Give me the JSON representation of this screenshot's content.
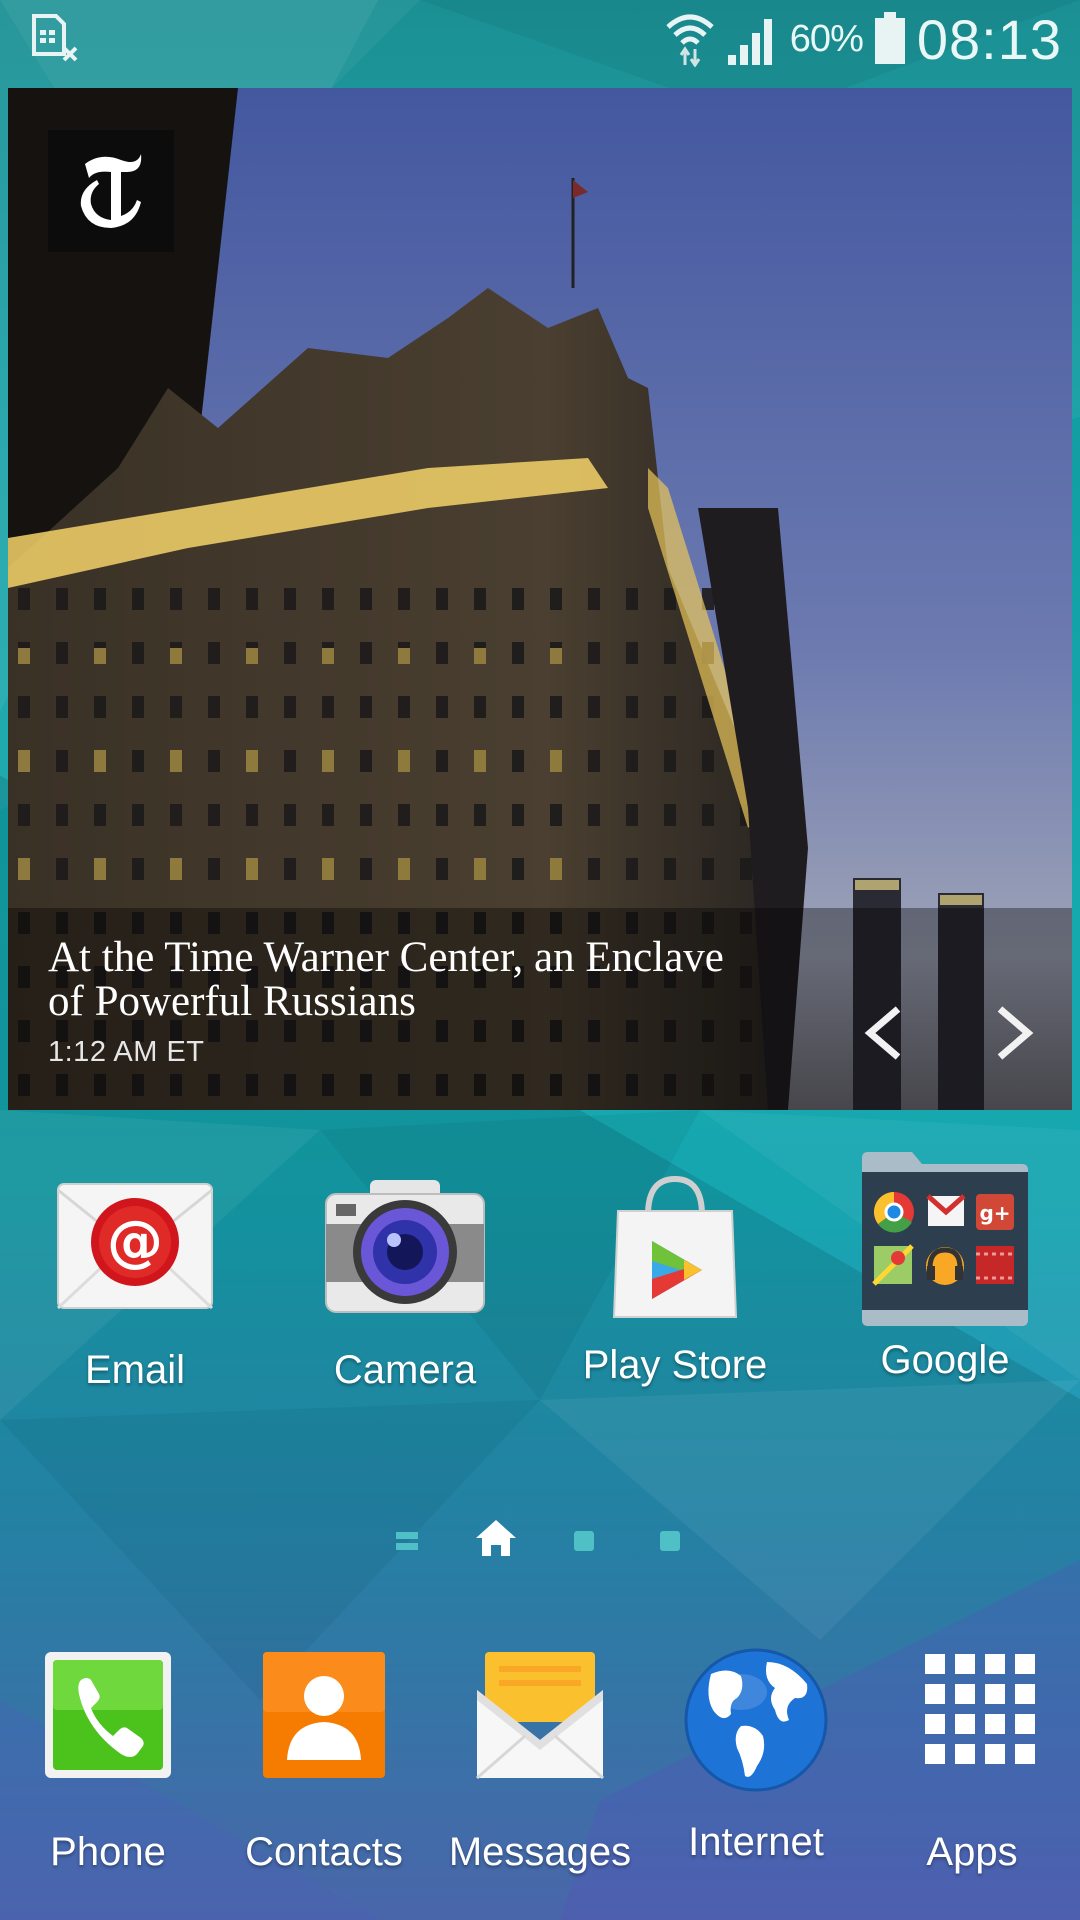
{
  "status_bar": {
    "battery_percent": "60%",
    "time": "08:13",
    "icons": [
      "sim-card-error-icon",
      "wifi-icon",
      "signal-icon",
      "battery-icon"
    ]
  },
  "news_widget": {
    "headline": "At the Time Warner Center, an Enclave of Powerful Russians",
    "timestamp": "1:12 AM ET",
    "logo": "nyt-t-logo"
  },
  "home_apps": [
    {
      "label": "Email",
      "icon": "email-icon"
    },
    {
      "label": "Camera",
      "icon": "camera-icon"
    },
    {
      "label": "Play Store",
      "icon": "play-store-icon"
    },
    {
      "label": "Google",
      "icon": "google-folder-icon"
    }
  ],
  "page_indicator": {
    "pages": [
      "list-page",
      "home-page",
      "page-3",
      "page-4"
    ],
    "current": "home-page"
  },
  "dock": [
    {
      "label": "Phone",
      "icon": "phone-icon"
    },
    {
      "label": "Contacts",
      "icon": "contacts-icon"
    },
    {
      "label": "Messages",
      "icon": "messages-icon"
    },
    {
      "label": "Internet",
      "icon": "internet-globe-icon"
    },
    {
      "label": "Apps",
      "icon": "apps-grid-icon"
    }
  ],
  "colors": {
    "wallpaper_top": "#0f8a8e",
    "wallpaper_bottom": "#5a6fc0",
    "email_red": "#d0161c",
    "phone_green": "#4cc21c",
    "contacts_orange": "#f57c00"
  }
}
